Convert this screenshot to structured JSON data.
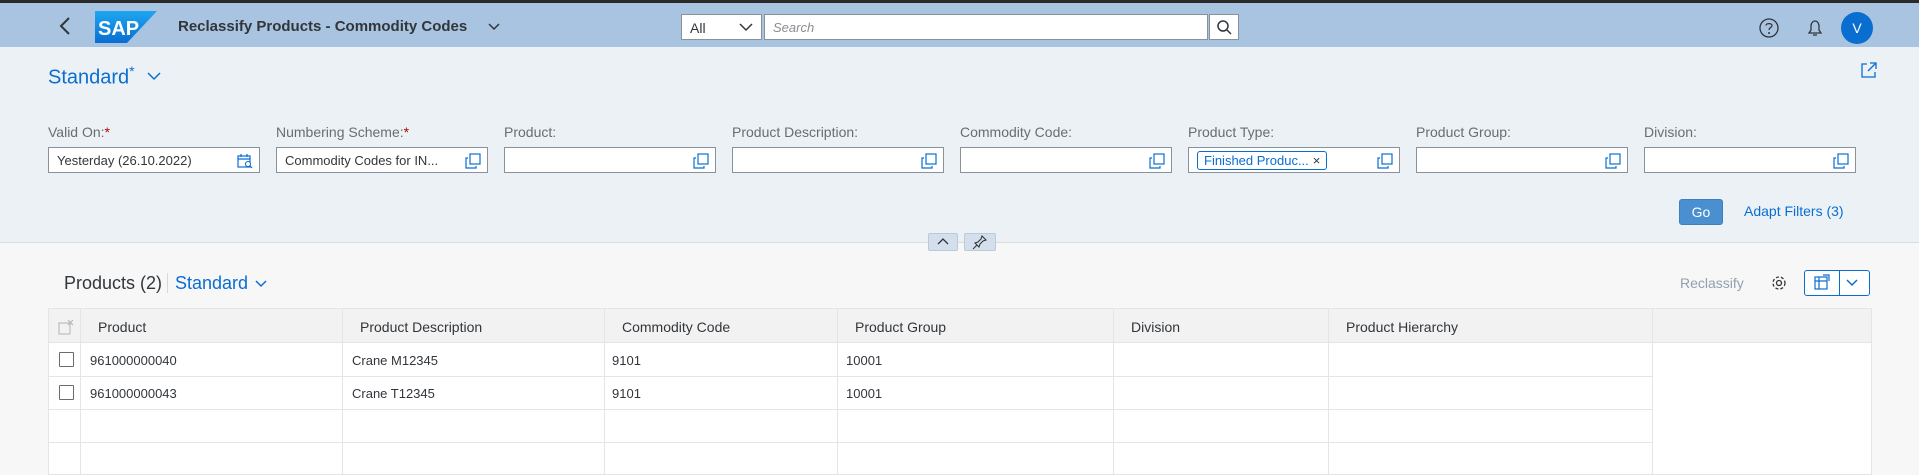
{
  "shell": {
    "app_title": "Reclassify Products - Commodity Codes",
    "scope_value": "All",
    "search_placeholder": "Search",
    "avatar_initial": "V",
    "logo_text": "SAP"
  },
  "filterbar": {
    "variant_name": "Standard",
    "variant_modified_mark": "*",
    "fields": [
      {
        "label": "Valid On:",
        "required": "*",
        "value": "Yesterday (26.10.2022)"
      },
      {
        "label": "Numbering Scheme:",
        "required": "*",
        "value": "Commodity Codes for IN..."
      },
      {
        "label": "Product:",
        "value": ""
      },
      {
        "label": "Product Description:",
        "value": ""
      },
      {
        "label": "Commodity Code:",
        "value": ""
      },
      {
        "label": "Product Type:",
        "token": "Finished Produc...",
        "token_remove": "×"
      },
      {
        "label": "Product Group:",
        "value": ""
      },
      {
        "label": "Division:",
        "value": ""
      }
    ],
    "go_label": "Go",
    "adapt_filters_label": "Adapt Filters (3)"
  },
  "table": {
    "title": "Products (2)",
    "variant_name": "Standard",
    "reclassify_label": "Reclassify",
    "columns": [
      "Product",
      "Product Description",
      "Commodity Code",
      "Product Group",
      "Division",
      "Product Hierarchy"
    ],
    "rows": [
      {
        "product": "961000000040",
        "description": "Crane M12345",
        "commodity_code": "9101",
        "product_group": "10001",
        "division": "",
        "hierarchy": ""
      },
      {
        "product": "961000000043",
        "description": "Crane T12345",
        "commodity_code": "9101",
        "product_group": "10001",
        "division": "",
        "hierarchy": ""
      }
    ]
  },
  "colors": {
    "shell_bg": "#a8c4e0",
    "accent": "#0a6ed1",
    "required": "#bb0000",
    "filterbar_bg": "#ecf1f6"
  },
  "icons": [
    "back-arrow-icon",
    "chevron-down-icon",
    "search-icon",
    "help-icon",
    "bell-icon",
    "share-icon",
    "calendar-icon",
    "value-help-icon",
    "settings-icon",
    "export-icon",
    "pin-icon",
    "collapse-icon"
  ]
}
